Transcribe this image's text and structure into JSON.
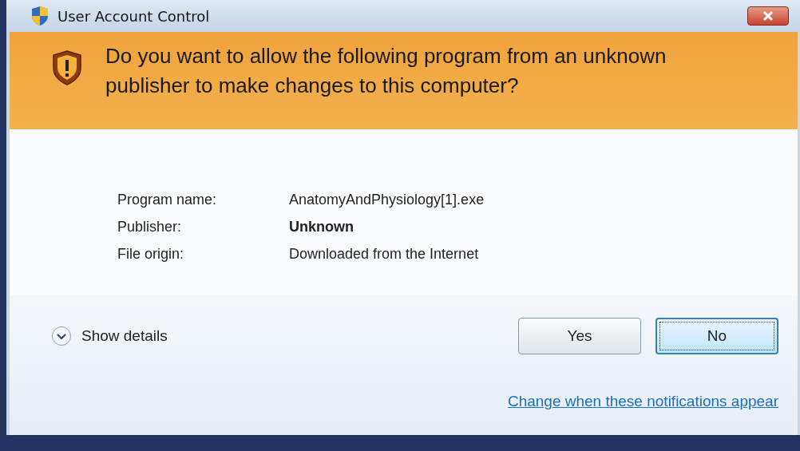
{
  "window": {
    "title": "User Account Control"
  },
  "heading": "Do you want to allow the following program from an unknown publisher to make changes to this computer?",
  "details": [
    {
      "label": "Program name:",
      "value": "AnatomyAndPhysiology[1].exe",
      "emphasized": false
    },
    {
      "label": "Publisher:",
      "value": "Unknown",
      "emphasized": true
    },
    {
      "label": "File origin:",
      "value": "Downloaded from the Internet",
      "emphasized": false
    }
  ],
  "show_details": {
    "label": "Show details",
    "expanded": false
  },
  "buttons": [
    {
      "label": "Yes",
      "focused": false
    },
    {
      "label": "No",
      "focused": true
    }
  ],
  "link": "Change when these notifications appear"
}
